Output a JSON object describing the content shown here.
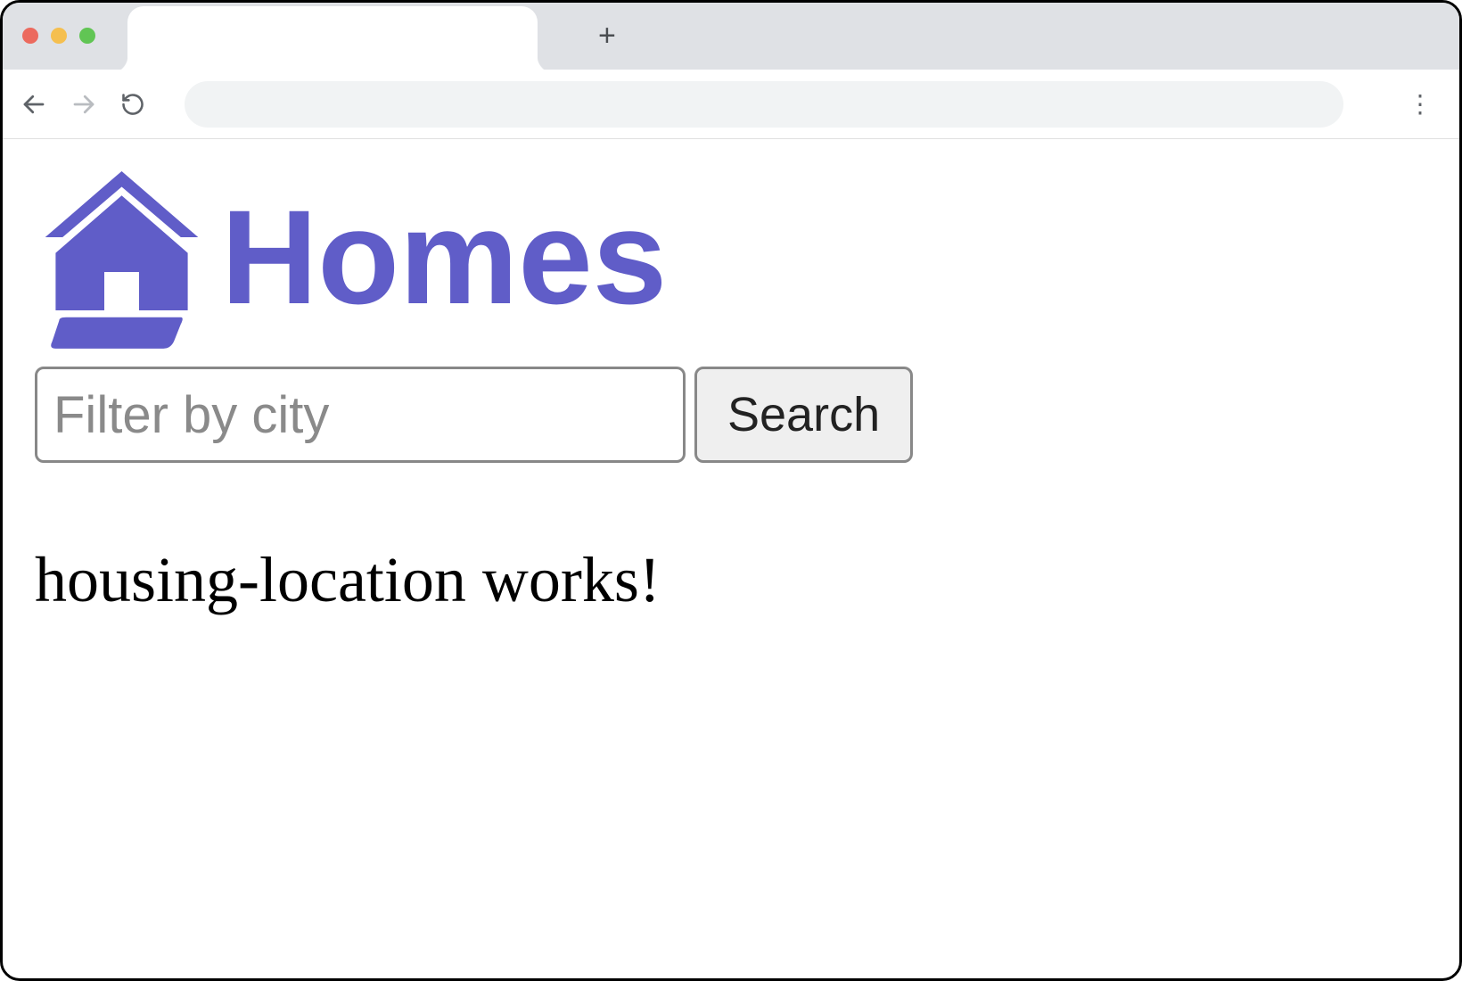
{
  "browser": {
    "newtab_symbol": "+",
    "kebab_symbol": "⋮"
  },
  "header": {
    "brand_name": "Homes",
    "brand_color": "#605dc8"
  },
  "search": {
    "placeholder": "Filter by city",
    "value": "",
    "button_label": "Search"
  },
  "content": {
    "message": "housing-location works!"
  }
}
